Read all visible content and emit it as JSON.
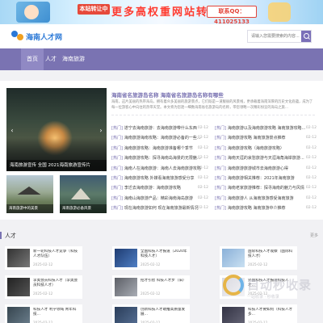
{
  "banner": {
    "tag": "本站转让中",
    "title": "更多高权重网站转让",
    "contact": "联系QQ：411025133"
  },
  "header": {
    "logo_text": "海南人才网",
    "search_placeholder": "请输入您需要搜索的内容..."
  },
  "nav": {
    "items": [
      "首页",
      "人才",
      "海南旅游"
    ]
  },
  "slider": {
    "caption": "海南旅游宣传 全国 2021海南旅游宣传片"
  },
  "thumbs": [
    {
      "caption": "海南旅游中的美景"
    },
    {
      "caption": "海南旅游必备风景"
    }
  ],
  "headline": {
    "title": "海南省名旅游岛名称 海南省名旅游岛名称有哪些",
    "desc": "海南，这片美丽的热带海岛，拥有着众多美丽的旅游景点，它们既是一道靓丽的风景线，更承载着海南深厚的历史文化底蕴，成为了每一位游客心中向往的热带天堂。本文将为您逐一细数海南省名旅游岛的名称，带您领略一次精彩纷呈的海岛之旅..."
  },
  "list_left": [
    {
      "tag": "[热门]",
      "text": "遂宁去海南旅游：去海南旅游带什么东西",
      "date": "02-12"
    },
    {
      "tag": "[热门]",
      "text": "海南旅游海南攻略：海南旅游必备的一些...",
      "date": "02-12"
    },
    {
      "tag": "[热门]",
      "text": "海南旅游攻略：海南旅游准备哪个季节",
      "date": "02-12"
    },
    {
      "tag": "[热门]",
      "text": "海南旅游攻略：探寻海南岛海景的无限魅...",
      "date": "02-12"
    },
    {
      "tag": "[热门]",
      "text": "海南人在海南旅游：海南人去海南旅游攻略",
      "date": "02-12"
    },
    {
      "tag": "[热门]",
      "text": "海南旅游攻略 外媒看海南旅游感受分享",
      "date": "02-12"
    },
    {
      "tag": "[热门]",
      "text": "李迁去海南旅游：海南旅游攻略",
      "date": "02-12"
    },
    {
      "tag": "[热门]",
      "text": "海南山海旅游产品：精彩海南海岛旅游",
      "date": "02-12"
    },
    {
      "tag": "[热门]",
      "text": "现在海南旅游如何 现在海南旅游最新情况",
      "date": "02-12"
    }
  ],
  "list_right": [
    {
      "tag": "[热门]",
      "text": "海南旅游以及海南旅游攻略 海南旅游攻略...",
      "date": "02-12"
    },
    {
      "tag": "[热门]",
      "text": "海南旅游攻略 海南旅游景点推荐",
      "date": "02-12"
    },
    {
      "tag": "[热门]",
      "text": "海南旅游攻略（海南旅游攻略）",
      "date": "02-12"
    },
    {
      "tag": "[热门]",
      "text": "海南天涯的哀愁旅游与天涯海角海岸旅游...",
      "date": "02-12"
    },
    {
      "tag": "[热门]",
      "text": "海南旅游旅游城市去海南旅游心得",
      "date": "02-12"
    },
    {
      "tag": "[热门]",
      "text": "海南旅游相关推荐：2021年海南旅游",
      "date": "02-12"
    },
    {
      "tag": "[热门]",
      "text": "海南老家旅游推荐：探寻海南的魅力与风情",
      "date": "02-12"
    },
    {
      "tag": "[热门]",
      "text": "海南旅游人 从海南旅游感受海南旅游",
      "date": "02-12"
    },
    {
      "tag": "[热门]",
      "text": "海南旅游攻略 海南旅游中介推荐",
      "date": "02-12"
    }
  ],
  "section": {
    "title": "人才",
    "more": "更多"
  },
  "cards": [
    {
      "title": "新一轮科技人才竞争（科技人才队伍）",
      "date": "2025-02-12"
    },
    {
      "title": "全国科技人才报道（2020年科技人才）",
      "date": "2025-02-12"
    },
    {
      "title": "国际科技人才观察（国际科技人才）",
      "date": "2025-02-12"
    },
    {
      "title": "李奥会员科技人才（李奥会员科技人才）",
      "date": "2025-02-12"
    },
    {
      "title": "招才引智 科技人才步（旧）",
      "date": "2025-02-12"
    },
    {
      "title": "外国科技人才报道科技人才...",
      "date": "2025-02-12"
    },
    {
      "title": "科技人才 利学领域 青年科技...",
      "date": "2025-02-12"
    },
    {
      "title": "创新科技人才助推高质量发展...",
      "date": "2025-02-12"
    },
    {
      "title": "科技人才要如何（科技人才多...",
      "date": "2025-02-12"
    }
  ],
  "watermark": {
    "text": "自动秒收录",
    "sub": "一站收录 · 秒收录"
  }
}
